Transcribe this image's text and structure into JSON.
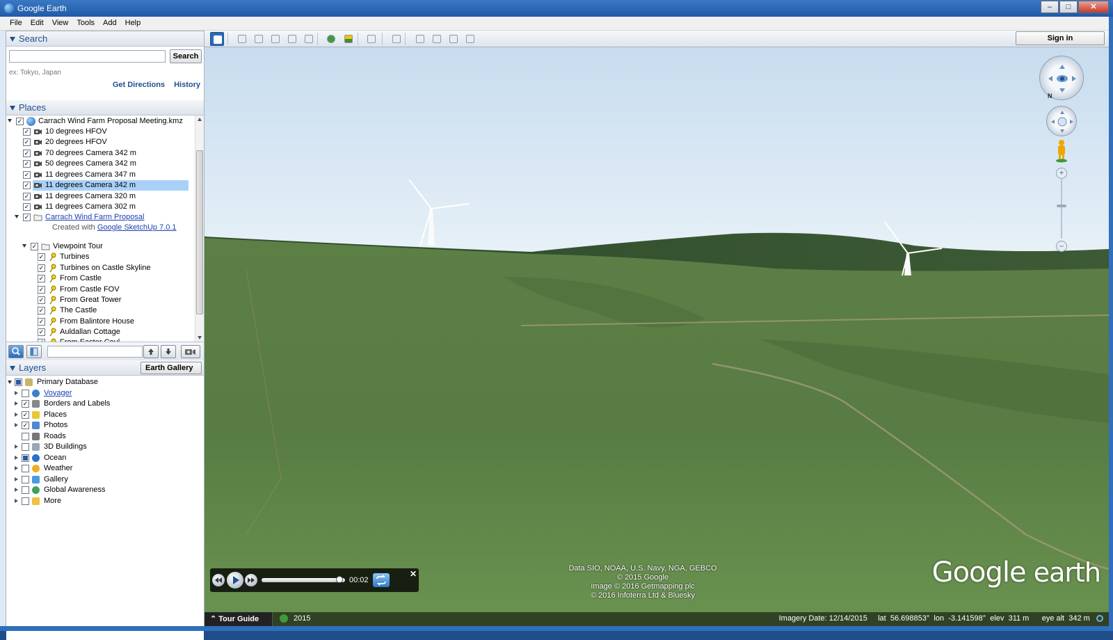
{
  "window": {
    "title": "Google Earth",
    "buttons": {
      "minimize": "–",
      "maximize": "□",
      "close": "✕"
    }
  },
  "menu": [
    "File",
    "Edit",
    "View",
    "Tools",
    "Add",
    "Help"
  ],
  "search": {
    "header": "Search",
    "input_value": "",
    "button_label": "Search",
    "hint": "ex: Tokyo, Japan",
    "links": [
      "Get Directions",
      "History"
    ]
  },
  "places": {
    "header": "Places",
    "items": [
      {
        "label": "Carrach Wind Farm Proposal Meeting.kmz",
        "checked": true,
        "icon": "globe-icon",
        "link": false,
        "selected": false
      },
      {
        "label": "10 degrees HFOV",
        "checked": true,
        "icon": "camera-icon",
        "link": false,
        "selected": false
      },
      {
        "label": "20 degrees HFOV",
        "checked": true,
        "icon": "camera-icon",
        "link": false,
        "selected": false
      },
      {
        "label": "70 degrees Camera 342 m",
        "checked": true,
        "icon": "camera-icon",
        "link": false,
        "selected": false
      },
      {
        "label": "50 degrees Camera 342 m",
        "checked": true,
        "icon": "camera-icon",
        "link": false,
        "selected": false
      },
      {
        "label": "11 degrees Camera 347 m",
        "checked": true,
        "icon": "camera-icon",
        "link": false,
        "selected": false
      },
      {
        "label": "11 degrees Camera 342 m",
        "checked": true,
        "icon": "camera-icon",
        "link": false,
        "selected": true
      },
      {
        "label": "11 degrees Camera 320 m",
        "checked": true,
        "icon": "camera-icon",
        "link": false,
        "selected": false
      },
      {
        "label": "11 degrees Camera 302 m",
        "checked": true,
        "icon": "camera-icon",
        "link": false,
        "selected": false
      },
      {
        "label": "Carrach Wind Farm Proposal",
        "checked": true,
        "icon": "folder-icon",
        "link": true,
        "selected": false
      },
      {
        "label": "Viewpoint Tour",
        "checked": true,
        "icon": "folder-icon",
        "link": false,
        "selected": false
      },
      {
        "label": "Turbines",
        "checked": true,
        "icon": "pushpin-icon",
        "link": false,
        "selected": false
      },
      {
        "label": "Turbines on Castle Skyline",
        "checked": true,
        "icon": "pushpin-icon",
        "link": false,
        "selected": false
      },
      {
        "label": "From Castle",
        "checked": true,
        "icon": "pushpin-icon",
        "link": false,
        "selected": false
      },
      {
        "label": "From Castle FOV",
        "checked": true,
        "icon": "pushpin-icon",
        "link": false,
        "selected": false
      },
      {
        "label": "From Great Tower",
        "checked": true,
        "icon": "pushpin-icon",
        "link": false,
        "selected": false
      },
      {
        "label": "The Castle",
        "checked": true,
        "icon": "pushpin-icon",
        "link": false,
        "selected": false
      },
      {
        "label": "From Balintore House",
        "checked": true,
        "icon": "pushpin-icon",
        "link": false,
        "selected": false
      },
      {
        "label": "Auldallan Cottage",
        "checked": true,
        "icon": "pushpin-icon",
        "link": false,
        "selected": false
      },
      {
        "label": "From Easter Coul",
        "checked": true,
        "icon": "pushpin-icon",
        "link": false,
        "selected": false
      }
    ],
    "created_with_prefix": "Created with ",
    "created_with_link": "Google SketchUp 7.0.1"
  },
  "layers": {
    "header": "Layers",
    "gallery_button": "Earth Gallery",
    "gallery_chevron": "»",
    "items": [
      {
        "label": "Primary Database",
        "checkbox": "partial",
        "icon": "database-icon",
        "link": false
      },
      {
        "label": "Voyager",
        "checkbox": "unchecked",
        "icon": "voyager-icon",
        "link": true
      },
      {
        "label": "Borders and Labels",
        "checkbox": "checked",
        "icon": "flag-icon",
        "link": false
      },
      {
        "label": "Places",
        "checkbox": "checked",
        "icon": "places-icon",
        "link": false
      },
      {
        "label": "Photos",
        "checkbox": "checked",
        "icon": "photos-icon",
        "link": false
      },
      {
        "label": "Roads",
        "checkbox": "unchecked",
        "icon": "roads-icon",
        "link": false
      },
      {
        "label": "3D Buildings",
        "checkbox": "unchecked",
        "icon": "buildings-icon",
        "link": false
      },
      {
        "label": "Ocean",
        "checkbox": "partial",
        "icon": "ocean-icon",
        "link": false
      },
      {
        "label": "Weather",
        "checkbox": "unchecked",
        "icon": "weather-icon",
        "link": false
      },
      {
        "label": "Gallery",
        "checkbox": "unchecked",
        "icon": "gallery-icon",
        "link": false
      },
      {
        "label": "Global Awareness",
        "checkbox": "unchecked",
        "icon": "global-awareness-icon",
        "link": false
      },
      {
        "label": "More",
        "checkbox": "unchecked",
        "icon": "more-icon",
        "link": false
      }
    ]
  },
  "toolbar": {
    "sign_in": "Sign in",
    "tools": [
      "sidebar-toggle-icon",
      "placemark-icon",
      "polygon-icon",
      "path-icon",
      "image-overlay-icon",
      "record-tour-icon",
      "historical-imagery-icon",
      "sunlight-icon",
      "planets-icon",
      "ruler-icon",
      "email-icon",
      "print-icon",
      "save-image-icon",
      "maps-icon"
    ]
  },
  "map": {
    "attribution": [
      "Data SIO, NOAA, U.S. Navy, NGA, GEBCO",
      "© 2015 Google",
      "Image © 2016 Getmapping plc",
      "© 2016 Infoterra Ltd & Bluesky"
    ],
    "logo_google": "Google",
    "logo_earth": " earth",
    "north_label": "N",
    "zoom_plus": "+",
    "zoom_minus": "–"
  },
  "tour_player": {
    "time": "00:02",
    "close": "✕",
    "progress": 0.95
  },
  "status": {
    "tour_guide": "Tour Guide",
    "year": "2015",
    "imagery_date_label": "Imagery Date: 12/14/2015",
    "lat_label": "lat",
    "lat": "56.698853°",
    "lon_label": "lon",
    "lon": "-3.141598°",
    "elev_label": "elev",
    "elev": "311 m",
    "eye_alt_label": "eye alt",
    "eye_alt": "342 m"
  }
}
